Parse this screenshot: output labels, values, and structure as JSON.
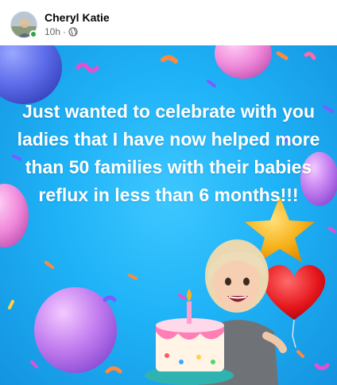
{
  "post": {
    "author": "Cheryl Katie",
    "timestamp": "10h",
    "separator": "·",
    "privacy_icon": "globe-icon",
    "online_status": "online",
    "text": "Just wanted to celebrate with you ladies that I have now helped more than 50 families with their babies reflux in less than 6 months!!!",
    "background_theme": "celebration",
    "background_color": "#1fb3f7"
  }
}
